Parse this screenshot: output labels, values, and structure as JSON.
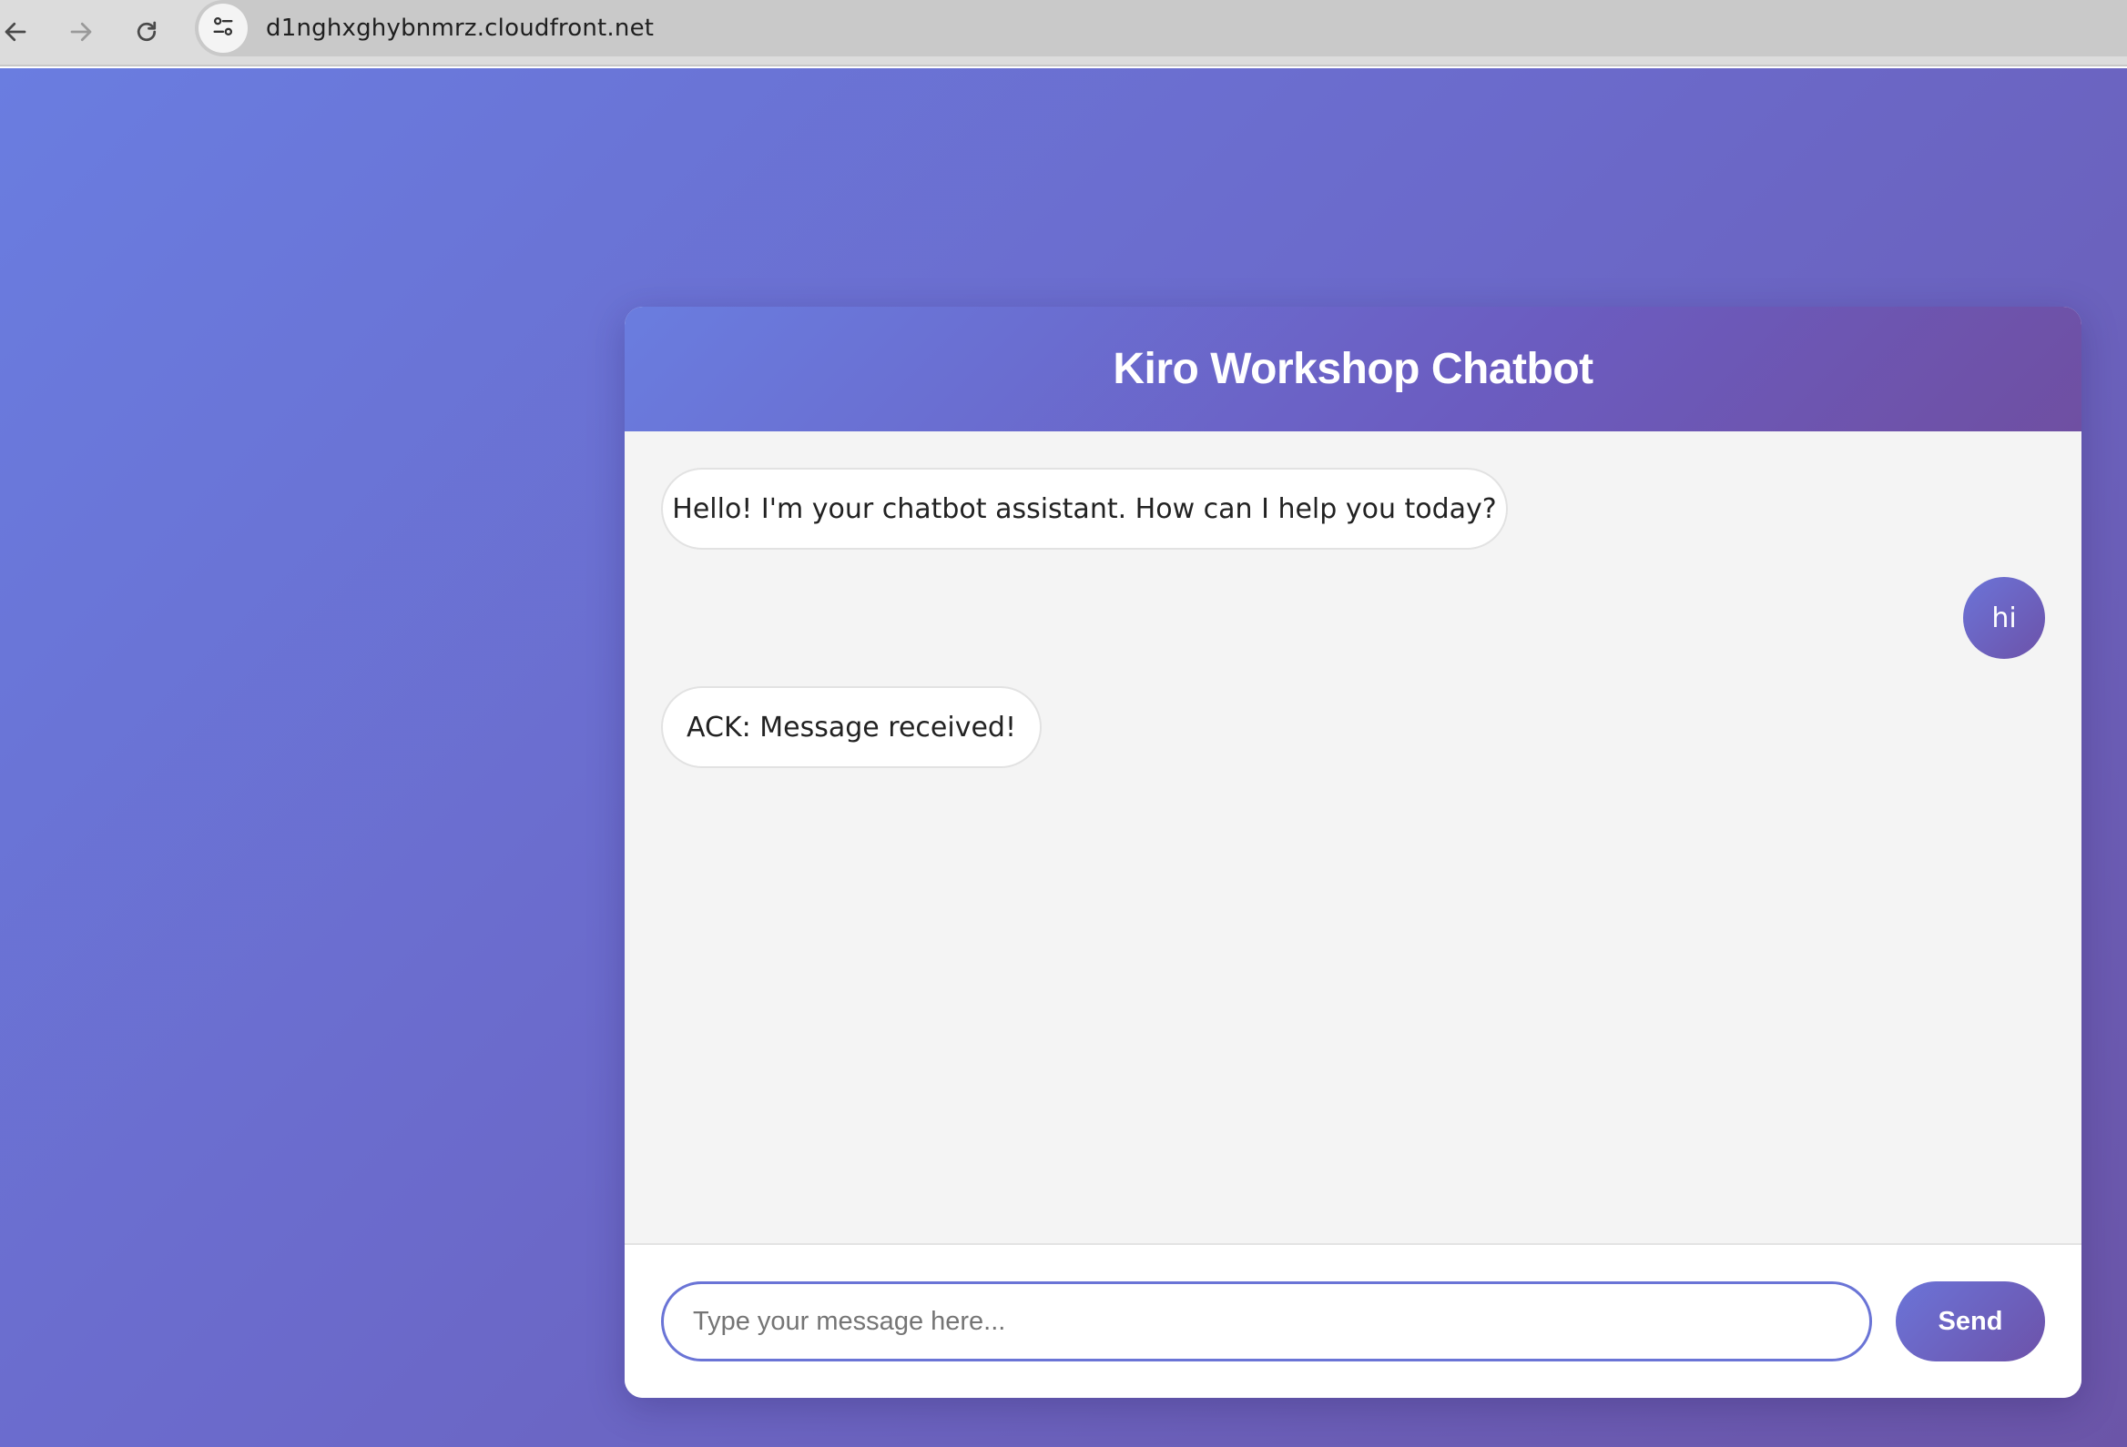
{
  "browser": {
    "url": "d1nghxghybnmrz.cloudfront.net",
    "icons": [
      "back-arrow-icon",
      "forward-arrow-icon",
      "reload-icon",
      "site-settings-icon"
    ]
  },
  "chat": {
    "title": "Kiro Workshop Chatbot",
    "messages": [
      {
        "sender": "bot",
        "text": "Hello! I'm your chatbot assistant. How can I help you today?"
      },
      {
        "sender": "user",
        "text": "hi"
      },
      {
        "sender": "bot",
        "text": "ACK: Message received!"
      }
    ],
    "input": {
      "value": "",
      "placeholder": "Type your message here..."
    },
    "send_label": "Send"
  },
  "colors": {
    "accent_start": "#6a7de0",
    "accent_end": "#6d52a9",
    "bot_bubble": "#ffffff",
    "messages_background": "#f4f4f4"
  }
}
